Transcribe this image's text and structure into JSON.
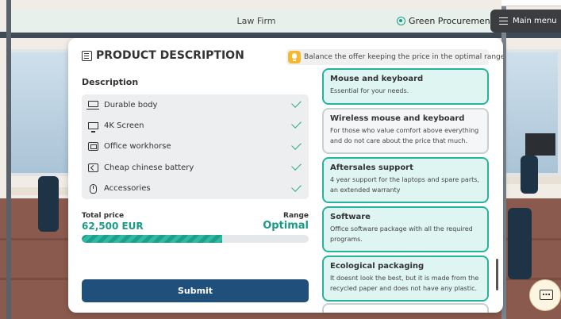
{
  "topbar": {
    "title": "Law Firm",
    "procurement_label": "Green Procurement",
    "menu_label": "Main menu"
  },
  "panel": {
    "title": "PRODUCT DESCRIPTION",
    "hint": "Balance the offer keeping the price in the optimal range",
    "description_heading": "Description",
    "features": [
      {
        "label": "Durable body",
        "icon": "laptop-icon",
        "selected": true
      },
      {
        "label": "4K Screen",
        "icon": "screen-icon",
        "selected": true
      },
      {
        "label": "Office workhorse",
        "icon": "office-icon",
        "selected": true
      },
      {
        "label": "Cheap chinese battery",
        "icon": "battery-icon",
        "selected": true
      },
      {
        "label": "Accessories",
        "icon": "mouse-icon",
        "selected": true
      }
    ],
    "total_price_label": "Total price",
    "total_price_value": "62,500 EUR",
    "range_label": "Range",
    "range_value": "Optimal",
    "price_progress": 0.62,
    "submit_label": "Submit"
  },
  "options": [
    {
      "title": "Mouse and keyboard",
      "desc": "Essential for your needs.",
      "selected": true
    },
    {
      "title": "Wireless mouse and keyboard",
      "desc": "For those who value comfort above everything and do not care about the price that much.",
      "selected": false
    },
    {
      "title": "Aftersales support",
      "desc": "4 year support for the laptops and spare parts, an extended warranty",
      "selected": true
    },
    {
      "title": "Software",
      "desc": "Office software package with all the required programs.",
      "selected": true
    },
    {
      "title": "Ecological packaging",
      "desc": "It doesnt look the best, but it is made from the recycled paper and does not have any plastic.",
      "selected": true
    }
  ],
  "colors": {
    "accent": "#1b9a86",
    "submit": "#1f4f7a",
    "card_selected_border": "#26b39c"
  }
}
